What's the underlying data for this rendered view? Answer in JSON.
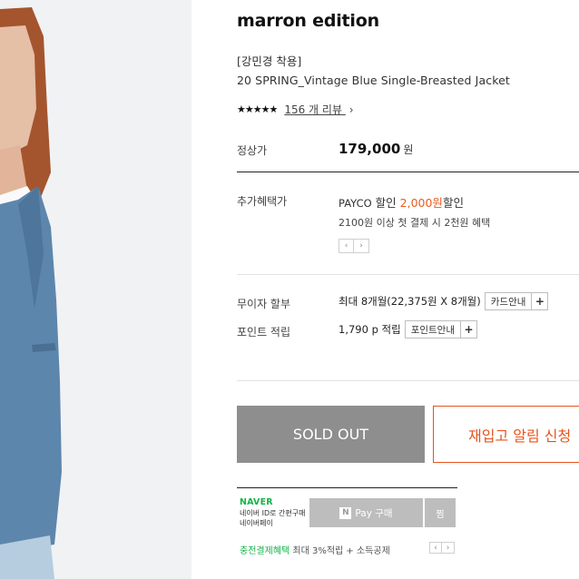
{
  "product": {
    "brand": "marron edition",
    "subtitle": "[강민경 착용]",
    "name": "20 SPRING_Vintage Blue Single-Breasted Jacket",
    "rating_stars": "★★★★★",
    "rating_value": 5,
    "review_link": "156 개 리뷰",
    "review_chevron": "›"
  },
  "price": {
    "label": "정상가",
    "value": "179,000",
    "unit": "원"
  },
  "benefit": {
    "label": "추가혜택가",
    "payco_brand": "PAYCO",
    "payco_text_1": "할인",
    "payco_amount": "2,000원",
    "payco_text_2": "할인",
    "payco_sub": "2100원 이상 첫 결제 시 2천원 혜택",
    "prev_arrow": "‹",
    "next_arrow": "›"
  },
  "installment": {
    "label": "무이자 할부",
    "value": "최대 8개월(22,375원 X 8개월)",
    "button": "카드안내",
    "plus": "+"
  },
  "points": {
    "label": "포인트 적립",
    "value": "1,790 p 적립",
    "button": "포인트안내",
    "plus": "+"
  },
  "actions": {
    "sold_out": "SOLD OUT",
    "restock": "재입고 알림 신청"
  },
  "naver": {
    "logo": "NAVER",
    "desc_line1": "네이버 ID로 간편구매",
    "desc_line2": "네이버페이",
    "pay_icon": "N",
    "pay_label": "Pay 구매",
    "wish_label": "찜",
    "footer_green": "충전결제혜택",
    "footer_text": "최대 3%적립 + 소득공제",
    "prev_arrow": "‹",
    "next_arrow": "›"
  },
  "colors": {
    "accent": "#ea5a1d",
    "sold_out_bg": "#8e8e8e",
    "naver_green": "#15b34a"
  }
}
